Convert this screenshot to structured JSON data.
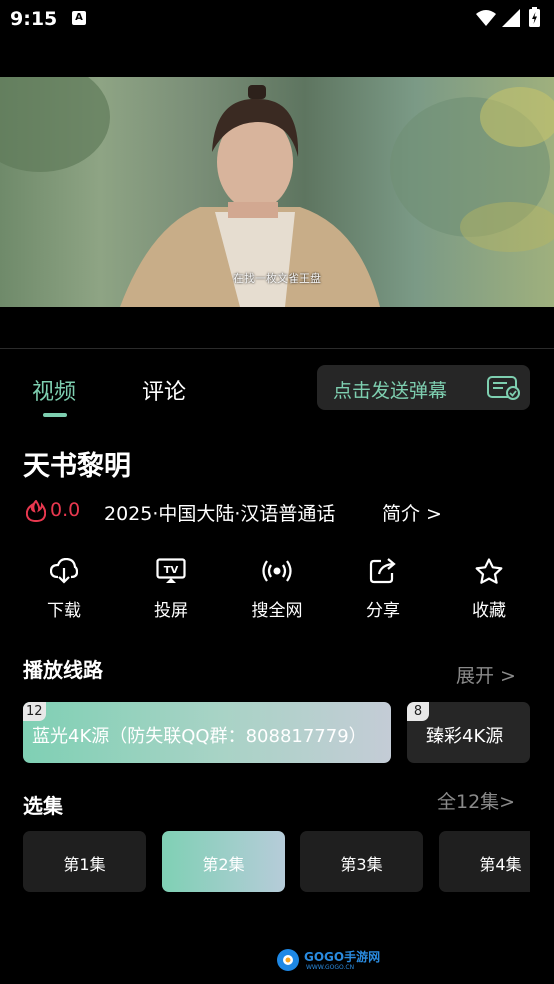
{
  "status_bar": {
    "time": "9:15",
    "notification_icon": "A"
  },
  "video": {
    "subtitle": "在找一枚文雀王盘"
  },
  "tabs": [
    {
      "label": "视频",
      "active": true
    },
    {
      "label": "评论",
      "active": false
    }
  ],
  "danmaku": {
    "label": "点击发送弹幕"
  },
  "show": {
    "title": "天书黎明",
    "rating": "0.0",
    "meta": "2025·中国大陆·汉语普通话",
    "intro_link": "简介 >"
  },
  "actions": [
    {
      "label": "下载",
      "icon": "download-cloud-icon"
    },
    {
      "label": "投屏",
      "icon": "tv-cast-icon"
    },
    {
      "label": "搜全网",
      "icon": "broadcast-icon"
    },
    {
      "label": "分享",
      "icon": "share-icon"
    },
    {
      "label": "收藏",
      "icon": "star-icon"
    }
  ],
  "routes": {
    "title": "播放线路",
    "expand": "展开 >",
    "items": [
      {
        "badge": "12",
        "label": "蓝光4K源（防失联QQ群：808817779）",
        "active": true
      },
      {
        "badge": "8",
        "label": "臻彩4K源",
        "active": false
      }
    ]
  },
  "episodes": {
    "title": "选集",
    "all": "全12集>",
    "items": [
      {
        "label": "第1集",
        "active": false
      },
      {
        "label": "第2集",
        "active": true
      },
      {
        "label": "第3集",
        "active": false
      },
      {
        "label": "第4集",
        "active": false
      }
    ]
  },
  "watermark": {
    "text": "GOGO手游网",
    "url": "WWW.GOGO.CN"
  },
  "colors": {
    "accent": "#7ecfb0",
    "fire": "#e8384f",
    "background": "#000000"
  }
}
